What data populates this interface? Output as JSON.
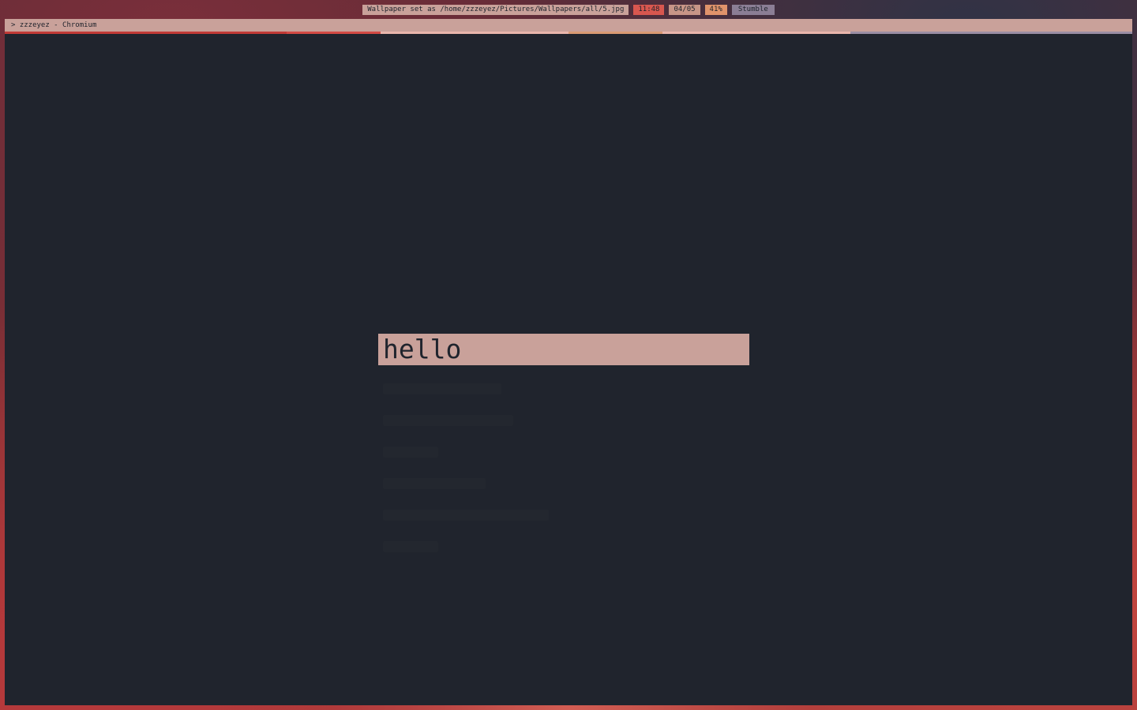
{
  "statusbar": {
    "message": "Wallpaper set as /home/zzzeyez/Pictures/Wallpapers/all/5.jpg",
    "time": "11:48",
    "date": "04/05",
    "battery": "41%",
    "workspace": "Stumble"
  },
  "window": {
    "title": "> zzzeyez - Chromium",
    "accent_colors": [
      "#c23a36",
      "#c23a36",
      "#c23a36",
      "#d34a44",
      "#e9b6ac",
      "#e9b6ac",
      "#d99a73",
      "#e9b6ac",
      "#e9b6ac",
      "#9a8ea4",
      "#9a8ea4",
      "#9a8ea4"
    ]
  },
  "launcher": {
    "query": "hello",
    "results": [
      "",
      "",
      "",
      "",
      "",
      ""
    ],
    "colors": {
      "prompt_bg": "#c9a19a",
      "prompt_text": "#20242d",
      "window_bg": "#20242d"
    }
  }
}
